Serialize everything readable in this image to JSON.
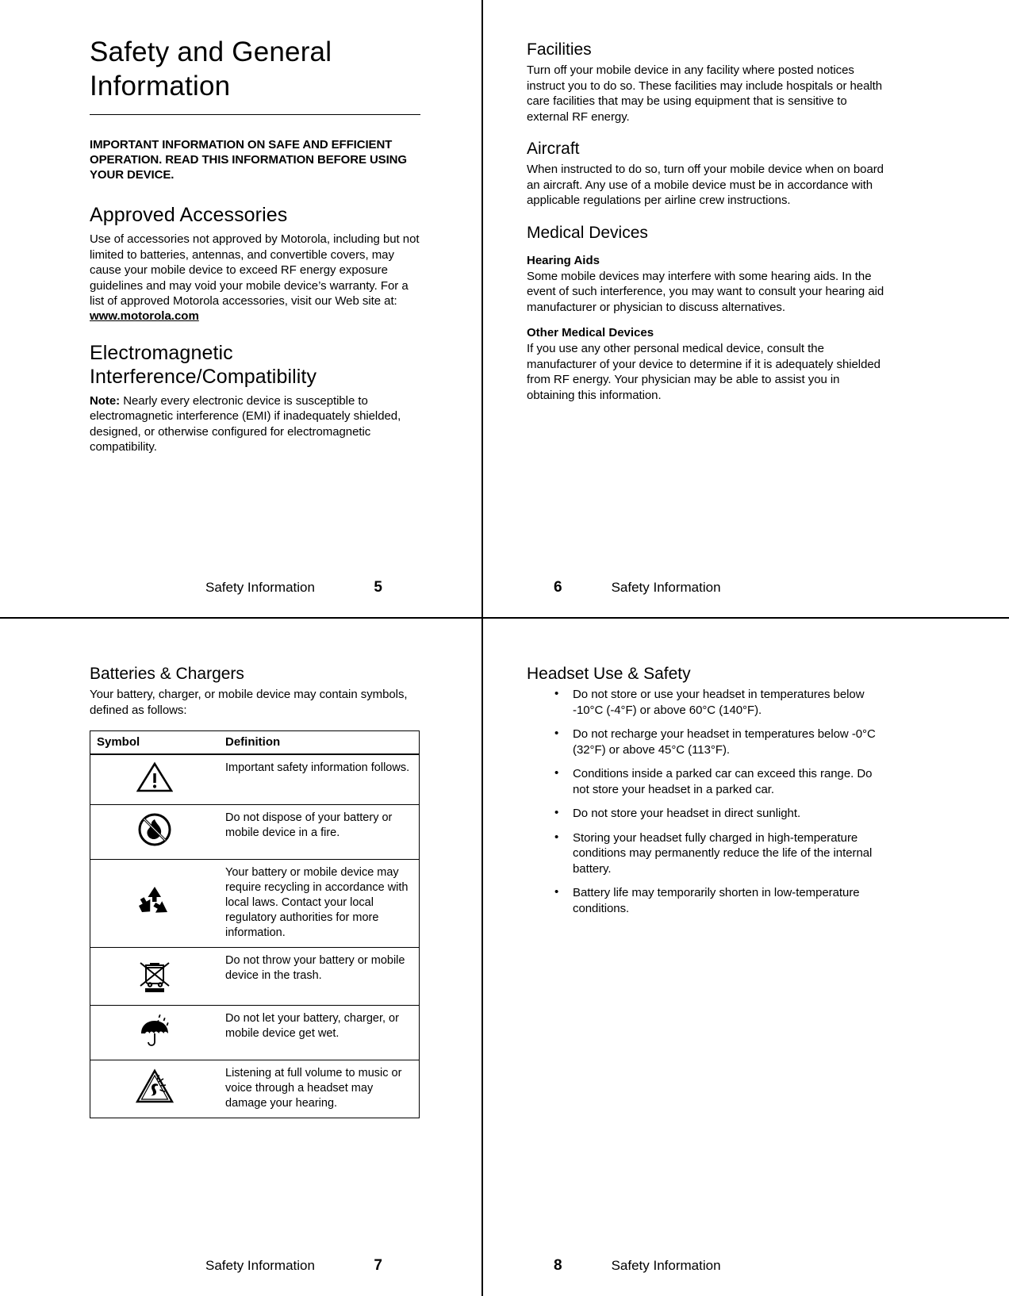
{
  "document": {
    "title": "Safety and General Information",
    "intro": "IMPORTANT INFORMATION ON SAFE AND EFFICIENT OPERATION. READ THIS INFORMATION BEFORE USING YOUR DEVICE."
  },
  "page5": {
    "number": "5",
    "footer_label": "Safety Information",
    "approved_accessories": {
      "heading": "Approved Accessories",
      "body": "Use of accessories not approved by Motorola, including but not limited to batteries, antennas, and convertible covers, may cause your mobile device to exceed RF energy exposure guidelines and may void your mobile device’s warranty. For a list of approved Motorola accessories, visit our Web site at:",
      "link": "www.motorola.com"
    },
    "emc": {
      "heading": "Electromagnetic Interference/Compatibility",
      "note_label": "Note:",
      "note_body": "Nearly every electronic device is susceptible to electromagnetic interference (EMI) if inadequately shielded, designed, or otherwise configured for electromagnetic compatibility."
    }
  },
  "page6": {
    "number": "6",
    "footer_label": "Safety Information",
    "facilities": {
      "heading": "Facilities",
      "body": "Turn off your mobile device in any facility where posted notices instruct you to do so. These facilities may include hospitals or health care facilities that may be using equipment that is sensitive to external RF energy."
    },
    "aircraft": {
      "heading": "Aircraft",
      "body": "When instructed to do so, turn off your mobile device when on board an aircraft. Any use of a mobile device must be in accordance with applicable regulations per airline crew instructions."
    },
    "medical_devices": {
      "heading": "Medical Devices",
      "hearing_aids": {
        "heading": "Hearing Aids",
        "body": "Some mobile devices may interfere with some hearing aids. In the event of such interference, you may want to consult your hearing aid manufacturer or physician to discuss alternatives."
      },
      "other_medical": {
        "heading": "Other Medical Devices",
        "body": "If you use any other personal medical device, consult the manufacturer of your device to determine if it is adequately shielded from RF energy. Your physician may be able to assist you in obtaining this information."
      }
    }
  },
  "page7": {
    "number": "7",
    "footer_label": "Safety Information",
    "batteries": {
      "heading": "Batteries & Chargers",
      "body": "Your battery, charger, or mobile device may contain symbols, defined as follows:"
    },
    "table": {
      "columns": [
        "Symbol",
        "Definition"
      ],
      "rows": [
        {
          "icon": "warning-triangle-icon",
          "definition": "Important safety information follows."
        },
        {
          "icon": "no-fire-icon",
          "definition": "Do not dispose of your battery or mobile device in a fire."
        },
        {
          "icon": "recycle-icon",
          "definition": "Your battery or mobile device may require recycling in accordance with local laws. Contact your local regulatory authorities for more information."
        },
        {
          "icon": "crossed-out-wheelie-bin-icon",
          "definition": "Do not throw your battery or mobile device in the trash."
        },
        {
          "icon": "keep-dry-umbrella-icon",
          "definition": "Do not let your battery, charger, or mobile device get wet."
        },
        {
          "icon": "hearing-damage-icon",
          "definition": "Listening at full volume to music or voice through a headset may damage your hearing."
        }
      ]
    }
  },
  "page8": {
    "number": "8",
    "footer_label": "Safety Information",
    "headset": {
      "heading": "Headset Use & Safety",
      "bullets": [
        "Do not store or use your headset in temperatures below -10°C (-4°F) or above 60°C (140°F).",
        "Do not recharge your headset in temperatures below -0°C (32°F) or above 45°C (113°F).",
        "Conditions inside a parked car can exceed this range. Do not store your headset in a parked car.",
        "Do not store your headset in direct sunlight.",
        "Storing your headset fully charged in high-temperature conditions may permanently reduce the life of the internal battery.",
        "Battery life may temporarily shorten in low-temperature conditions."
      ]
    }
  },
  "colors": {
    "ink": "#000000",
    "paper": "#ffffff"
  }
}
